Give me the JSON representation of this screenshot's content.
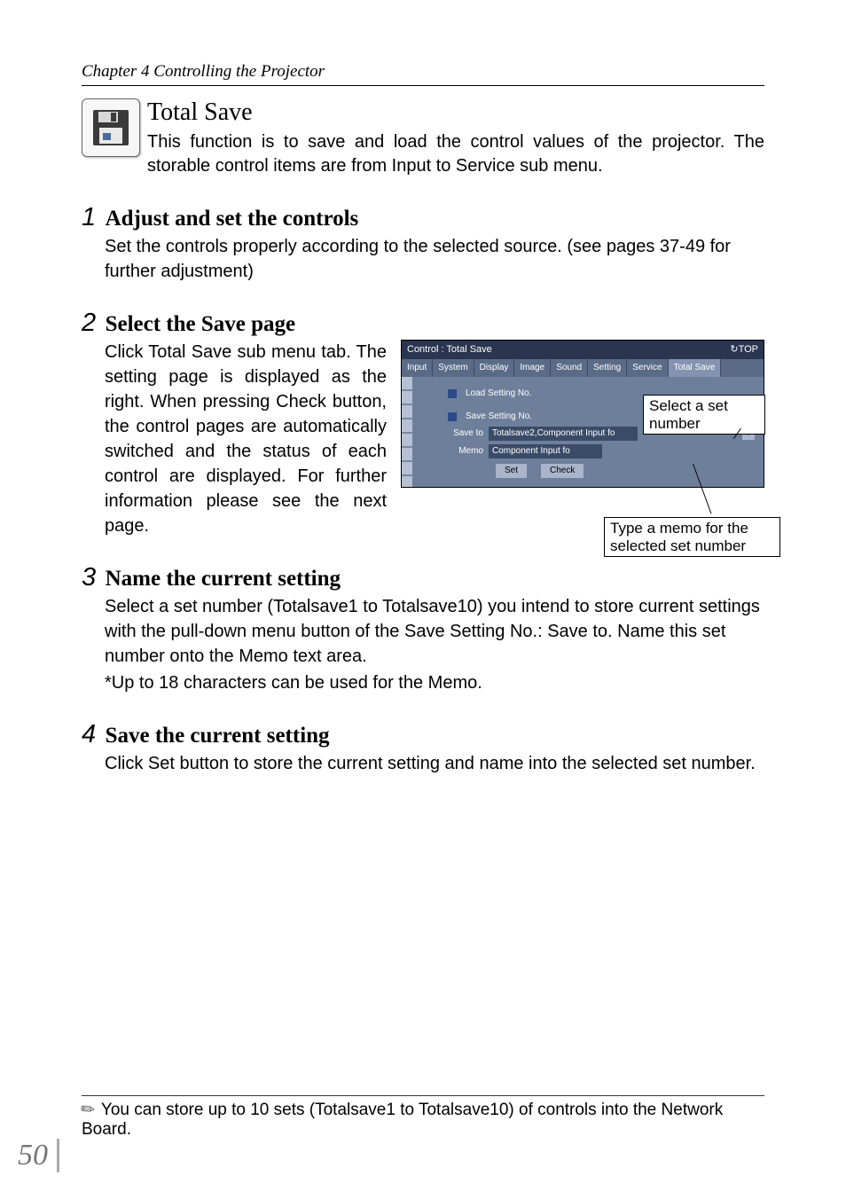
{
  "chapter": "Chapter 4 Controlling the Projector",
  "section": {
    "title": "Total Save",
    "body": "This function is to save and load the control values of the projector. The storable control items are from Input to Service sub menu."
  },
  "steps": [
    {
      "num": "1",
      "title": "Adjust and set the controls",
      "body": "Set the controls properly according to the selected source. (see pages 37-49 for further adjustment)"
    },
    {
      "num": "2",
      "title": "Select the Save page",
      "body_a": "Click ",
      "body_b": "Total Save",
      "body_c": " sub menu tab. The setting page is displayed as the right. When pressing ",
      "body_d": "Check",
      "body_e": " button, the control pages are automatically switched and the status of each control are displayed. For further information please see the next page."
    },
    {
      "num": "3",
      "title": "Name the current setting",
      "body_a": "Select a set number (Totalsave1 to Totalsave10) you intend to store current settings with the pull-down menu button of the ",
      "body_b": "Save Setting No.: Save to",
      "body_c": ". Name this set number onto the ",
      "body_d": "Memo",
      "body_e": " text area.",
      "fine": "*Up to 18 characters can be used for the Memo."
    },
    {
      "num": "4",
      "title": "Save the current setting",
      "body_a": "Click ",
      "body_b": "Set",
      "body_c": " button to store the current setting and name into the selected set number."
    }
  ],
  "shot": {
    "window_title": "Control : Total Save",
    "top_link": "TOP",
    "tabs": [
      "Input",
      "System",
      "Display",
      "Image",
      "Sound",
      "Setting",
      "Service",
      "Total Save"
    ],
    "load_label": "Load Setting No.",
    "save_label": "Save Setting No.",
    "save_to_label": "Save to",
    "save_to_value": "Totalsave2,Component Input fo",
    "memo_label": "Memo",
    "memo_value": "Component Input fo",
    "set_btn": "Set",
    "check_btn": "Check"
  },
  "callouts": {
    "set_number": "Select a set number",
    "memo_hint": "Type a memo for the selected set number"
  },
  "footnote": "You can store up to 10 sets (Totalsave1 to Totalsave10) of controls into the Network Board.",
  "page_number": "50"
}
